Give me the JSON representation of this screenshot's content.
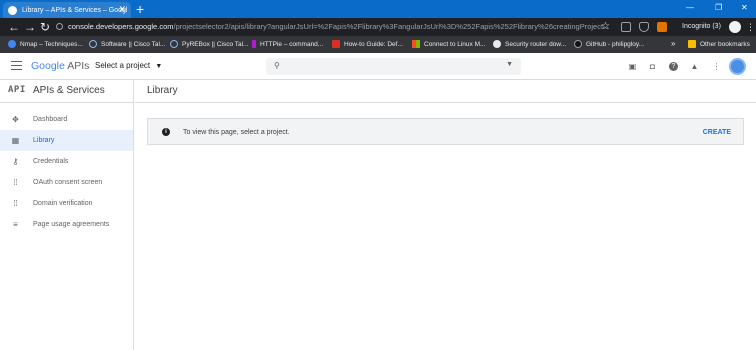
{
  "browser": {
    "tab_title": "Library – APIs & Services – Googl",
    "url_host": "console.developers.google.com",
    "url_path": "/projectselector2/apis/library?angularJsUrl=%2Fapis%2Flibrary%3FangularJsUrl%3D%252Fapis%252Flibrary%26creatingProject...",
    "incognito_label": "Incognito (3)",
    "bookmarks": [
      {
        "label": "Nmap – Techniques...",
        "color": "#4285f4"
      },
      {
        "label": "Software || Cisco Tal...",
        "color": "#1a73e8"
      },
      {
        "label": "PyREBox || Cisco Tal...",
        "color": "#1a73e8"
      },
      {
        "label": "HTTPie – command...",
        "color": "#b31bd1"
      },
      {
        "label": "How-to Guide: Def...",
        "color": "#d93025"
      },
      {
        "label": "Connect to Linux M...",
        "color": "#f9ab00"
      },
      {
        "label": "Security router dow...",
        "color": "#e8eaed"
      },
      {
        "label": "GitHub - philipgloy...",
        "color": "#202124"
      }
    ],
    "more_bookmarks": "»",
    "other_bookmarks": "Other bookmarks"
  },
  "appbar": {
    "logo_google": "Google",
    "logo_apis": "APIs",
    "project_selector": "Select a project"
  },
  "sidebar": {
    "api_badge": "API",
    "title": "APIs & Services",
    "items": [
      {
        "label": "Dashboard",
        "icon": "dashboard-icon",
        "active": false
      },
      {
        "label": "Library",
        "icon": "library-icon",
        "active": true
      },
      {
        "label": "Credentials",
        "icon": "key-icon",
        "active": false
      },
      {
        "label": "OAuth consent screen",
        "icon": "consent-icon",
        "active": false
      },
      {
        "label": "Domain verification",
        "icon": "domain-icon",
        "active": false
      },
      {
        "label": "Page usage agreements",
        "icon": "agreements-icon",
        "active": false
      }
    ]
  },
  "main": {
    "title": "Library",
    "banner_message": "To view this page, select a project.",
    "banner_action": "CREATE"
  },
  "colors": {
    "titlebar": "#0b6bc9",
    "accent": "#1a73e8",
    "active_nav_bg": "#e8f0fe"
  }
}
